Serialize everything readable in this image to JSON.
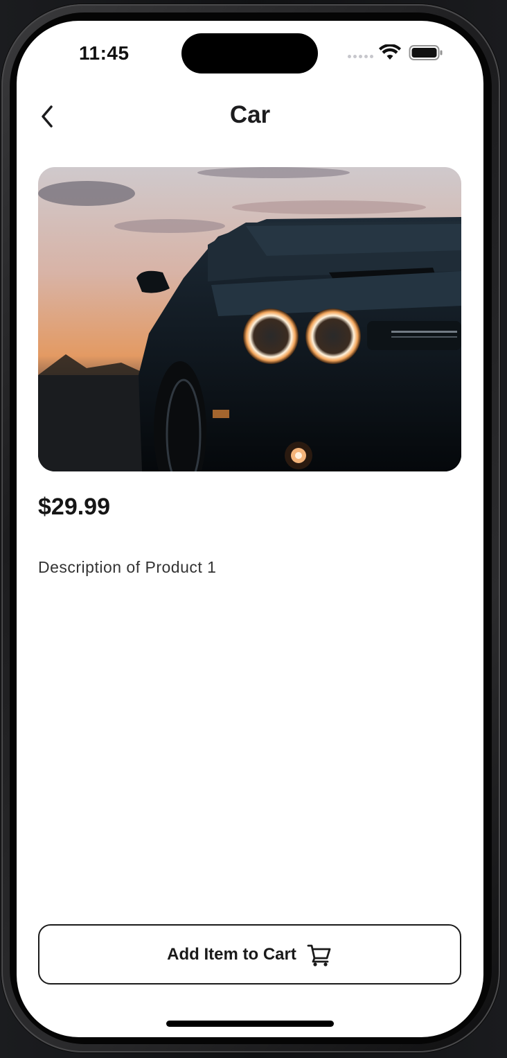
{
  "status_bar": {
    "time": "11:45"
  },
  "nav": {
    "back_icon": "chevron-left-icon",
    "title": "Car"
  },
  "product": {
    "image_alt": "Car",
    "price": "$29.99",
    "description": "Description of Product 1"
  },
  "actions": {
    "add_to_cart_label": "Add Item to Cart",
    "add_to_cart_icon": "cart-icon"
  },
  "colors": {
    "background": "#ffffff",
    "text_primary": "#1c1c1e",
    "button_border": "#1a1a1a"
  }
}
